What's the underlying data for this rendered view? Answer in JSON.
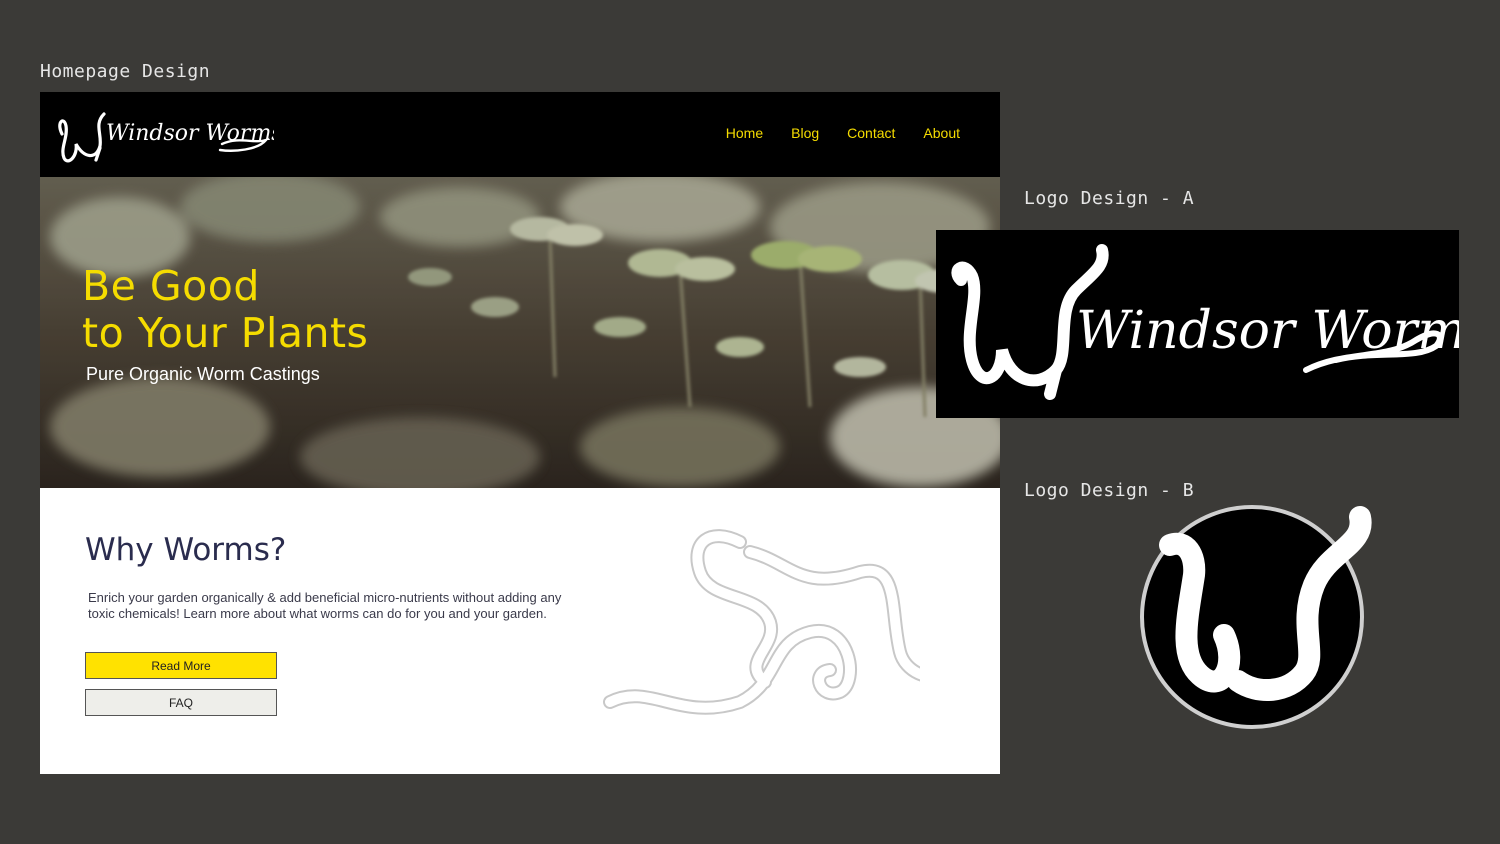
{
  "labels": {
    "homepage": "Homepage Design",
    "logo_a": "Logo Design - A",
    "logo_b": "Logo Design - B"
  },
  "site": {
    "brand": "Windsor Worms",
    "nav": {
      "items": [
        {
          "label": "Home"
        },
        {
          "label": "Blog"
        },
        {
          "label": "Contact"
        },
        {
          "label": "About"
        }
      ]
    },
    "hero": {
      "title": "Be Good\nto Your Plants",
      "subtitle": "Pure Organic Worm Castings"
    },
    "why": {
      "title": "Why Worms?",
      "body": "Enrich your garden organically & add beneficial micro-nutrients without adding any toxic chemicals! Learn more about what worms can do for you and your garden."
    },
    "buttons": {
      "read_more": "Read More",
      "faq": "FAQ"
    }
  },
  "colors": {
    "page_bg": "#3b3a37",
    "accent_yellow": "#f5dc00",
    "button_yellow": "#ffe200",
    "heading_navy": "#2a2c4e",
    "nav_bg": "#000000"
  }
}
